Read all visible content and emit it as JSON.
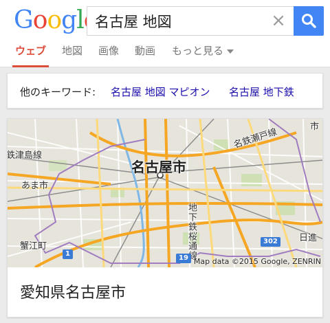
{
  "header": {
    "logo_letters": [
      {
        "ch": "G",
        "color": "#4285f4"
      },
      {
        "ch": "o",
        "color": "#ea4335"
      },
      {
        "ch": "o",
        "color": "#fbbc05"
      },
      {
        "ch": "g",
        "color": "#4285f4"
      },
      {
        "ch": "l",
        "color": "#34a853"
      },
      {
        "ch": "e",
        "color": "#ea4335"
      }
    ],
    "search_value": "名古屋 地図",
    "clear_icon": "×",
    "search_button_color": "#4285f4"
  },
  "tabs": {
    "items": [
      "ウェブ",
      "地図",
      "画像",
      "動画",
      "もっと見る"
    ],
    "active_index": 0,
    "active_color": "#dd4b39"
  },
  "keywords": {
    "label": "他のキーワード:",
    "links": [
      "名古屋 地図 マピオン",
      "名古屋 地下鉄"
    ],
    "link_color": "#1a0dab"
  },
  "map": {
    "labels": {
      "city": "名古屋市",
      "tsushima_line": "鉄津島線",
      "ama": "あま市",
      "kanie": "蟹江町",
      "seto_line": "名鉄瀬戸線",
      "subway_sakuradori": "地下鉄桜通線",
      "nisshin": "日進",
      "top_right": "市"
    },
    "routes": [
      "1",
      "19",
      "302"
    ],
    "attribution": "Map data ©2015 Google, ZENRIN"
  },
  "place": {
    "title": "愛知県名古屋市"
  }
}
